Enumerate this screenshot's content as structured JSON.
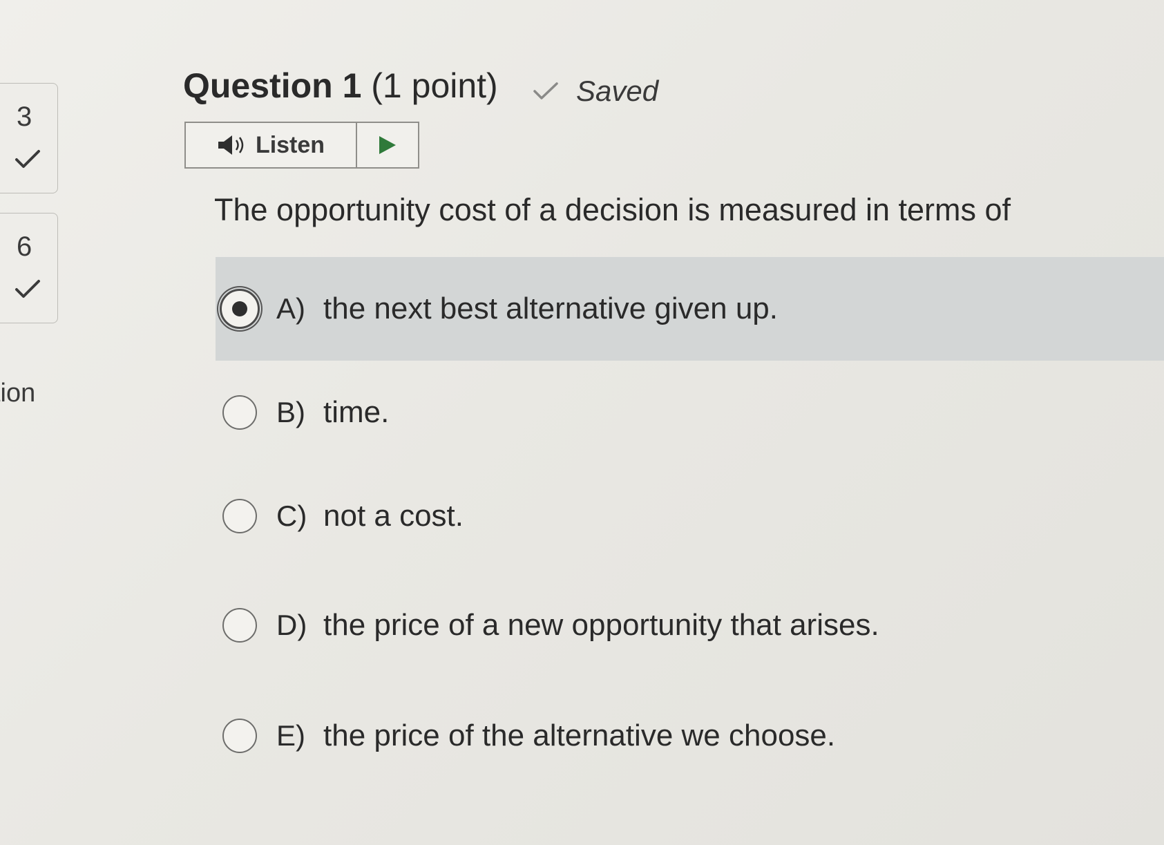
{
  "nav": {
    "items": [
      {
        "number": "3",
        "status_icon": "check-icon"
      },
      {
        "number": "6",
        "status_icon": "check-icon"
      }
    ],
    "fragment": "tion"
  },
  "question": {
    "title_number": "Question 1",
    "title_points": "(1 point)",
    "saved_label": "Saved",
    "listen_label": "Listen",
    "prompt": "The opportunity cost of a decision is measured in terms of"
  },
  "options": [
    {
      "letter": "A)",
      "text": "the next best alternative given up.",
      "selected": true
    },
    {
      "letter": "B)",
      "text": "time.",
      "selected": false
    },
    {
      "letter": "C)",
      "text": "not a cost.",
      "selected": false
    },
    {
      "letter": "D)",
      "text": "the price of a new opportunity that arises.",
      "selected": false
    },
    {
      "letter": "E)",
      "text": "the price of the alternative we choose.",
      "selected": false
    }
  ],
  "colors": {
    "background": "#e8e7e2",
    "selected_row": "#d3d6d6",
    "play_green": "#2f7a3a",
    "saved_check": "#8a8a88"
  }
}
